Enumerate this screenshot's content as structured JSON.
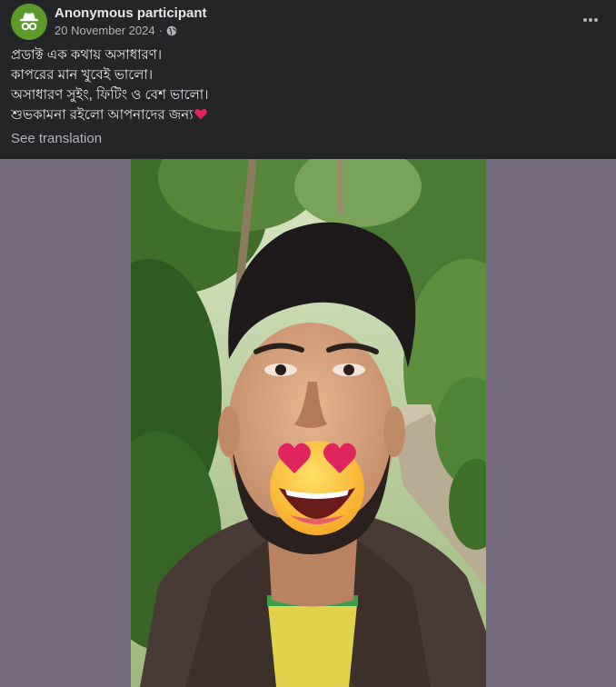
{
  "post": {
    "author_name": "Anonymous participant",
    "date": "20 November 2024",
    "separator": "·",
    "audience_icon": "globe-icon",
    "more_icon": "more-options-icon",
    "text_lines": [
      "প্রডাক্ট এক কথায় অসাধারণ।",
      "কাপরের মান খুবেই ভালো।",
      "অসাধারণ সুইং, ফিটিং ও বেশ ভালো।",
      "শুভকামনা রইলো আপনাদের জন্য"
    ],
    "end_emoji": "heart-icon",
    "see_translation": "See translation"
  },
  "media": {
    "subject": "selfie photo of a person outdoors with a heart-eyes emoji over the mouth",
    "overlay_emoji": "heart-eyes-emoji"
  },
  "colors": {
    "background": "#242526",
    "media_backdrop": "#776b80",
    "avatar": "#5b9b2b",
    "text_primary": "#e4e6eb",
    "text_secondary": "#b0b3b8"
  }
}
